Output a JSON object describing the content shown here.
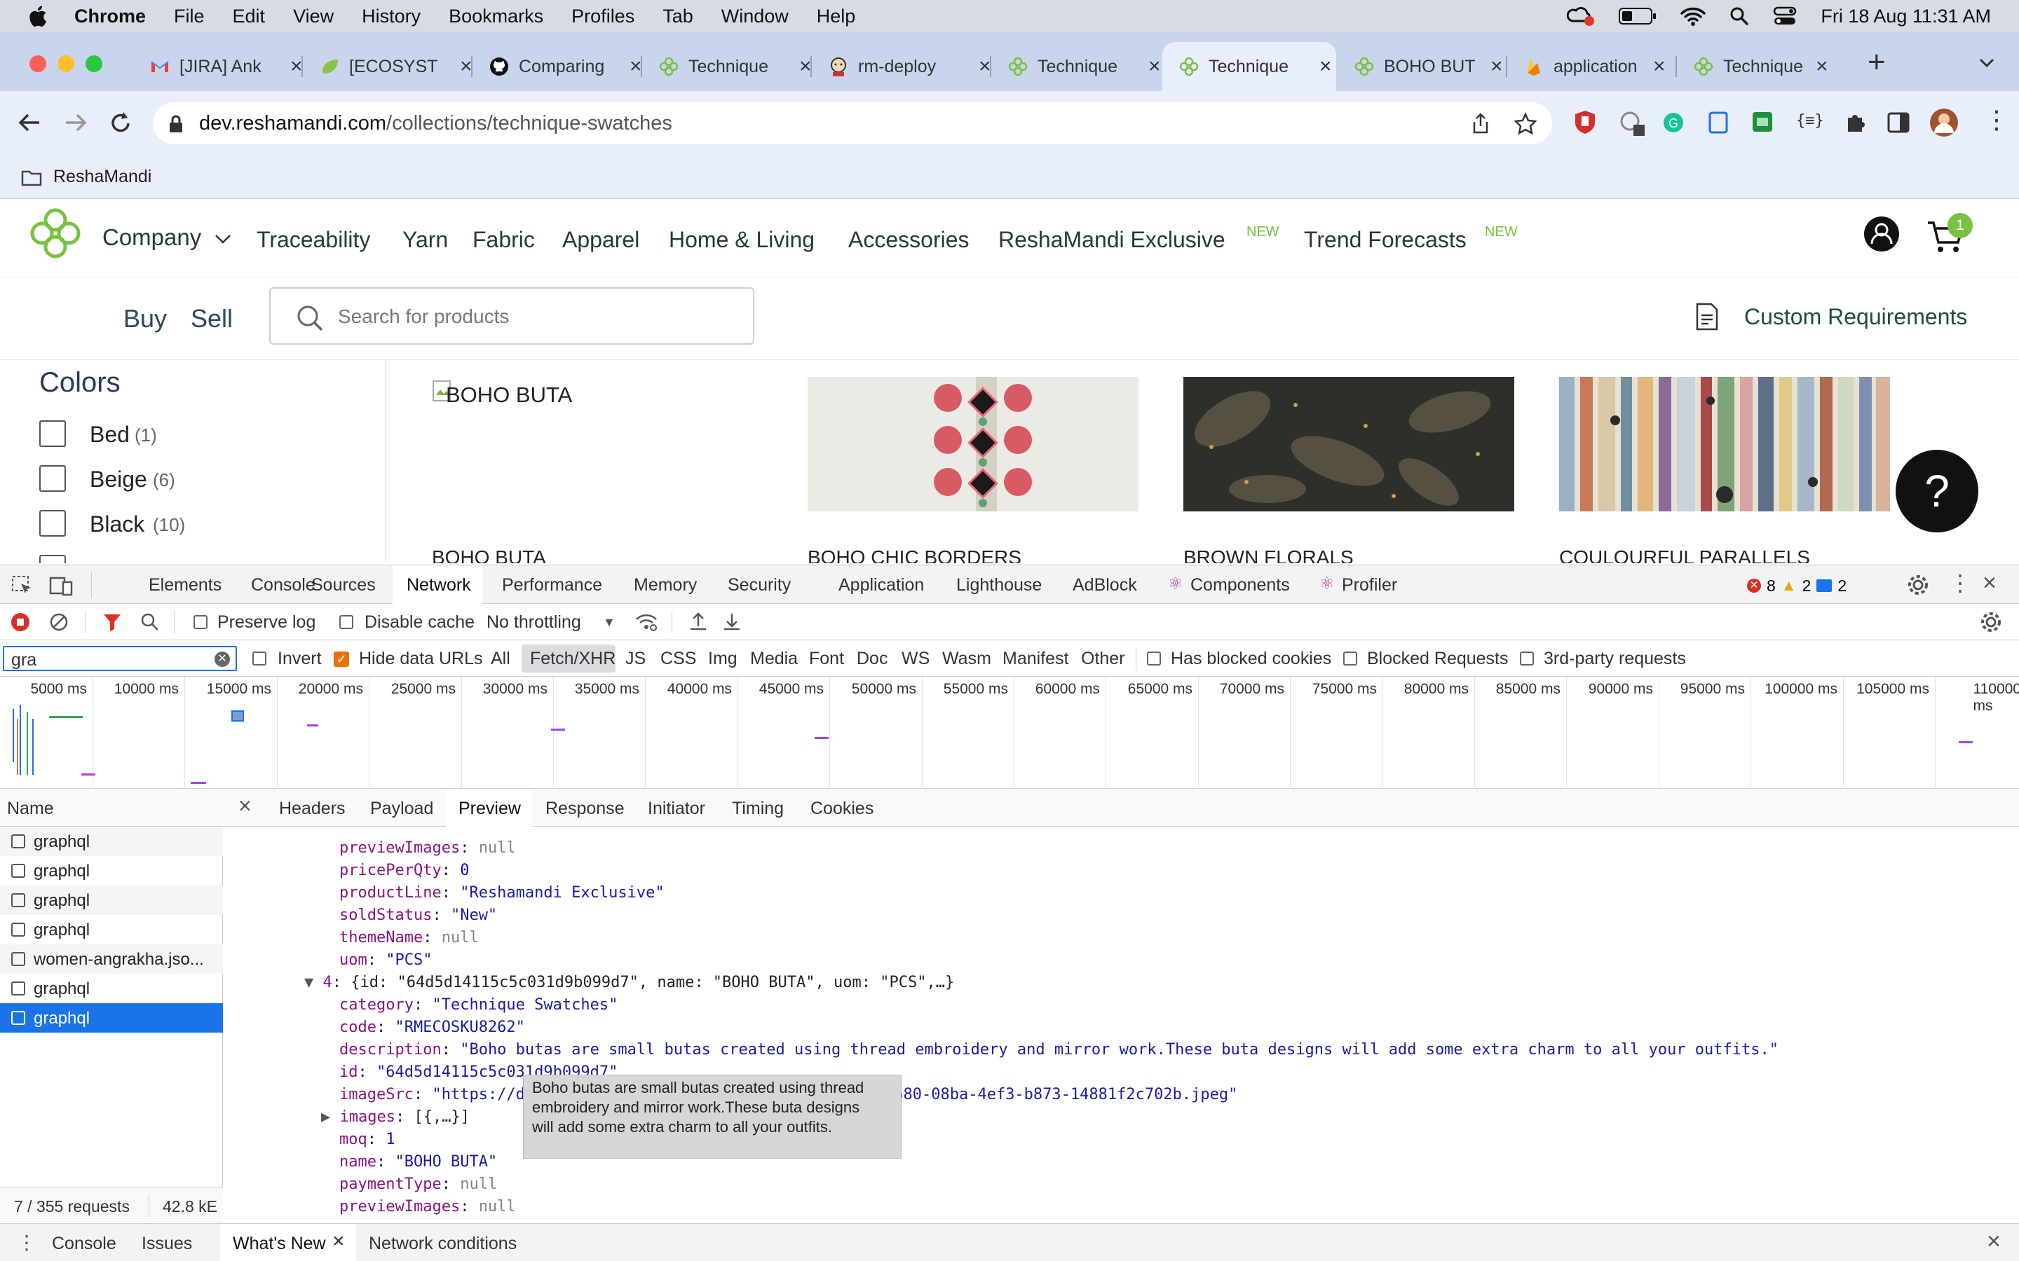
{
  "menubar": {
    "app": "Chrome",
    "items": [
      "File",
      "Edit",
      "View",
      "History",
      "Bookmarks",
      "Profiles",
      "Tab",
      "Window",
      "Help"
    ],
    "clock": "Fri 18 Aug  11:31 AM"
  },
  "tabs": [
    {
      "title": "[JIRA] Ank",
      "icon": "gmail-icon"
    },
    {
      "title": "[ECOSYST",
      "icon": "leaf-icon"
    },
    {
      "title": "Comparing",
      "icon": "github-icon"
    },
    {
      "title": "Technique",
      "icon": "reshamandi-icon"
    },
    {
      "title": "rm-deploy",
      "icon": "jenkins-icon"
    },
    {
      "title": "Technique",
      "icon": "reshamandi-icon"
    },
    {
      "title": "Technique",
      "icon": "reshamandi-icon",
      "active": true
    },
    {
      "title": "BOHO BUT",
      "icon": "reshamandi-icon"
    },
    {
      "title": "application",
      "icon": "firebase-icon"
    },
    {
      "title": "Technique",
      "icon": "reshamandi-icon"
    }
  ],
  "address": {
    "host": "dev.reshamandi.com",
    "path": "/collections/technique-swatches"
  },
  "bookmarks": {
    "folder": "ReshaMandi"
  },
  "site": {
    "nav": [
      "Company",
      "Traceability",
      "Yarn",
      "Fabric",
      "Apparel",
      "Home & Living",
      "Accessories",
      "ReshaMandi Exclusive",
      "Trend Forecasts"
    ],
    "new_badge": "NEW",
    "cart_count": "1",
    "buy": "Buy",
    "sell": "Sell",
    "search_placeholder": "Search for products",
    "custom_req": "Custom Requirements",
    "filter_title": "Colors",
    "colors": [
      {
        "name": "Bed",
        "count": "(1)"
      },
      {
        "name": "Beige",
        "count": "(6)"
      },
      {
        "name": "Black",
        "count": "(10)"
      }
    ],
    "products": [
      "BOHO BUTA",
      "BOHO CHIC BORDERS",
      "BROWN FLORALS",
      "COULOURFUL PARALLELS"
    ],
    "broken_img_alt": "BOHO BUTA",
    "help_glyph": "?"
  },
  "devtools": {
    "tabs": [
      "Elements",
      "Console",
      "Sources",
      "Network",
      "Performance",
      "Memory",
      "Security",
      "Application",
      "Lighthouse",
      "AdBlock",
      "Components",
      "Profiler"
    ],
    "active_tab": "Network",
    "errors": "8",
    "warnings": "2",
    "messages": "2",
    "toolbar": {
      "preserve_log": "Preserve log",
      "disable_cache": "Disable cache",
      "throttling": "No throttling"
    },
    "filter": {
      "value": "gra",
      "invert": "Invert",
      "hide_data_urls": "Hide data URLs",
      "types": [
        "All",
        "Fetch/XHR",
        "JS",
        "CSS",
        "Img",
        "Media",
        "Font",
        "Doc",
        "WS",
        "Wasm",
        "Manifest",
        "Other"
      ],
      "active_type": "Fetch/XHR",
      "blocked_cookies": "Has blocked cookies",
      "blocked_requests": "Blocked Requests",
      "third_party": "3rd-party requests"
    },
    "timeline_ticks": [
      "5000 ms",
      "10000 ms",
      "15000 ms",
      "20000 ms",
      "25000 ms",
      "30000 ms",
      "35000 ms",
      "40000 ms",
      "45000 ms",
      "50000 ms",
      "55000 ms",
      "60000 ms",
      "65000 ms",
      "70000 ms",
      "75000 ms",
      "80000 ms",
      "85000 ms",
      "90000 ms",
      "95000 ms",
      "100000 ms",
      "105000 ms",
      "110000 ms"
    ],
    "name_header": "Name",
    "requests": [
      "graphql",
      "graphql",
      "graphql",
      "graphql",
      "women-angrakha.jso...",
      "graphql",
      "graphql"
    ],
    "selected_request": 6,
    "summary": {
      "requests": "7 / 355 requests",
      "size": "42.8 kE"
    },
    "detail_tabs": [
      "Headers",
      "Payload",
      "Preview",
      "Response",
      "Initiator",
      "Timing",
      "Cookies"
    ],
    "active_detail_tab": "Preview",
    "preview": {
      "previewImages_1": "null",
      "pricePerQty": "0",
      "productLine": "\"Reshamandi Exclusive\"",
      "soldStatus": "\"New\"",
      "themeName": "null",
      "uom": "\"PCS\"",
      "item_summary": "{id: \"64d5d14115c5c031d9b099d7\", name: \"BOHO BUTA\", uom: \"PCS\",…}",
      "item_index": "4",
      "category": "\"Technique Swatches\"",
      "code": "\"RMECOSKU8262\"",
      "description": "\"Boho butas are small butas created using thread embroidery and mirror work.These buta designs will add some extra charm to all your outfits.\"",
      "id": "\"64d5d14115c5c031d9b099d7\"",
      "imageSrc_start": "\"https://d",
      "imageSrc_end": "f680-08ba-4ef3-b873-14881f2c702b.jpeg\"",
      "images": "[{,…}]",
      "moq": "1",
      "name": "\"BOHO BUTA\"",
      "paymentType": "null",
      "previewImages_2": "null"
    },
    "tooltip": [
      "Boho butas are small butas created using thread",
      "embroidery and mirror work.These buta designs",
      "will add some extra charm to all your outfits."
    ],
    "drawer_tabs": [
      "Console",
      "Issues",
      "What's New",
      "Network conditions"
    ],
    "active_drawer_tab": "What's New"
  },
  "colors": {
    "brand_green": "#79c142",
    "devtools_blue": "#1a73e8",
    "selected_row": "#1a73e8"
  }
}
